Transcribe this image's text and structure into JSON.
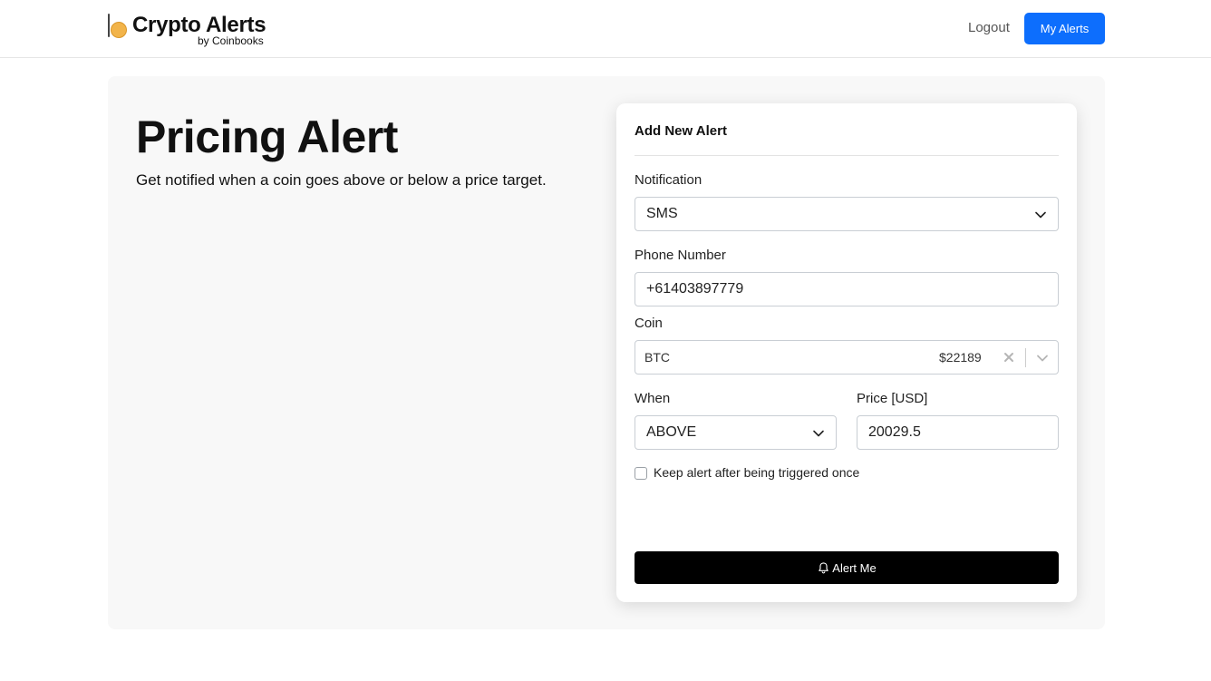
{
  "brand": {
    "title": "Crypto Alerts",
    "subtitle": "by Coinbooks"
  },
  "nav": {
    "logout_label": "Logout",
    "my_alerts_label": "My Alerts"
  },
  "hero": {
    "title": "Pricing Alert",
    "subtitle": "Get notified when a coin goes above or below a price target."
  },
  "form": {
    "title": "Add New Alert",
    "notification": {
      "label": "Notification",
      "value": "SMS"
    },
    "phone": {
      "label": "Phone Number",
      "value": "+61403897779"
    },
    "coin": {
      "label": "Coin",
      "symbol": "BTC",
      "price": "$22189"
    },
    "when": {
      "label": "When",
      "value": "ABOVE"
    },
    "price": {
      "label": "Price [USD]",
      "value": "20029.5"
    },
    "keep_alert": {
      "label": "Keep alert after being triggered once",
      "checked": false
    },
    "submit_label": "Alert Me"
  },
  "colors": {
    "primary": "#0d6efd",
    "submit": "#000000",
    "panel": "#f8f8f8",
    "coin": "#f2b44a"
  },
  "icons": [
    "coin-logo",
    "chevron-down-icon",
    "clear-icon",
    "bell-icon"
  ]
}
